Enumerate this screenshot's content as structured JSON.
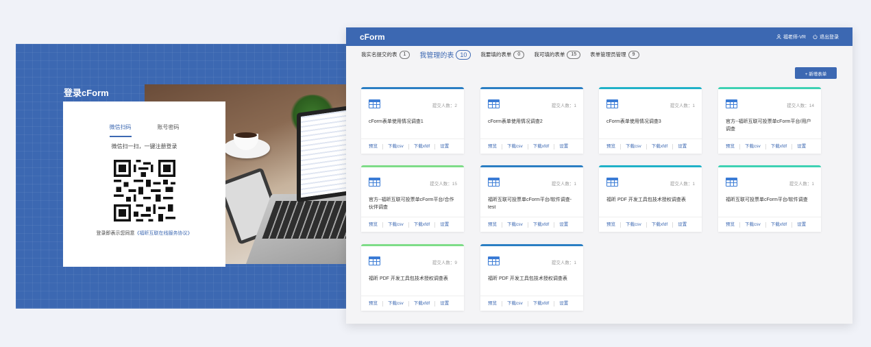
{
  "login": {
    "title": "登录cForm",
    "tabs": [
      "微信扫码",
      "账号密码"
    ],
    "active_tab": 0,
    "scan_tip": "微信扫一扫，一键注册登录",
    "agree_prefix": "登录即表示您同意",
    "agree_link": "《福昕互联在线服务协议》"
  },
  "header": {
    "brand": "cForm",
    "user": "福老师-VR",
    "logout": "退出登录"
  },
  "nav": [
    {
      "label": "我实名提交的表",
      "count": "1"
    },
    {
      "label": "我管理的表",
      "count": "10",
      "active": true
    },
    {
      "label": "我要填的表单",
      "count": "0"
    },
    {
      "label": "我可填的表单",
      "count": "15"
    },
    {
      "label": "表单管理员管理",
      "count": "9"
    }
  ],
  "new_button": "+ 新增表单",
  "cards": [
    {
      "title": "cForm表单使用情况调查1",
      "count_label": "提交人数：2",
      "color": "blue"
    },
    {
      "title": "cForm表单使用情况调查2",
      "count_label": "提交人数：1",
      "color": "blue"
    },
    {
      "title": "cForm表单使用情况调查3",
      "count_label": "提交人数：1",
      "color": "cyan"
    },
    {
      "title": "官方--福昕互联可投票单cForm平台/用户调查",
      "count_label": "提交人数：14",
      "color": "teal"
    },
    {
      "title": "官方--福昕互联可投票单cForm平台/合作伙伴调查",
      "count_label": "提交人数：15",
      "color": "green"
    },
    {
      "title": "福昕互联可投票单cForm平台/软件调查-test",
      "count_label": "提交人数：1",
      "color": "blue"
    },
    {
      "title": "福昕 PDF 开发工具包技术授权调查表",
      "count_label": "提交人数：1",
      "color": "cyan"
    },
    {
      "title": "福昕互联可投票单cForm平台/软件调查",
      "count_label": "提交人数：1",
      "color": "teal"
    },
    {
      "title": "福昕 PDF 开发工具包技术授权调查表",
      "count_label": "提交人数：9",
      "color": "green"
    },
    {
      "title": "福昕 PDF 开发工具包技术授权调查表",
      "count_label": "提交人数：1",
      "color": "blue"
    }
  ],
  "card_actions": [
    "预览",
    "下载csv",
    "下载xfdf",
    "设置"
  ]
}
